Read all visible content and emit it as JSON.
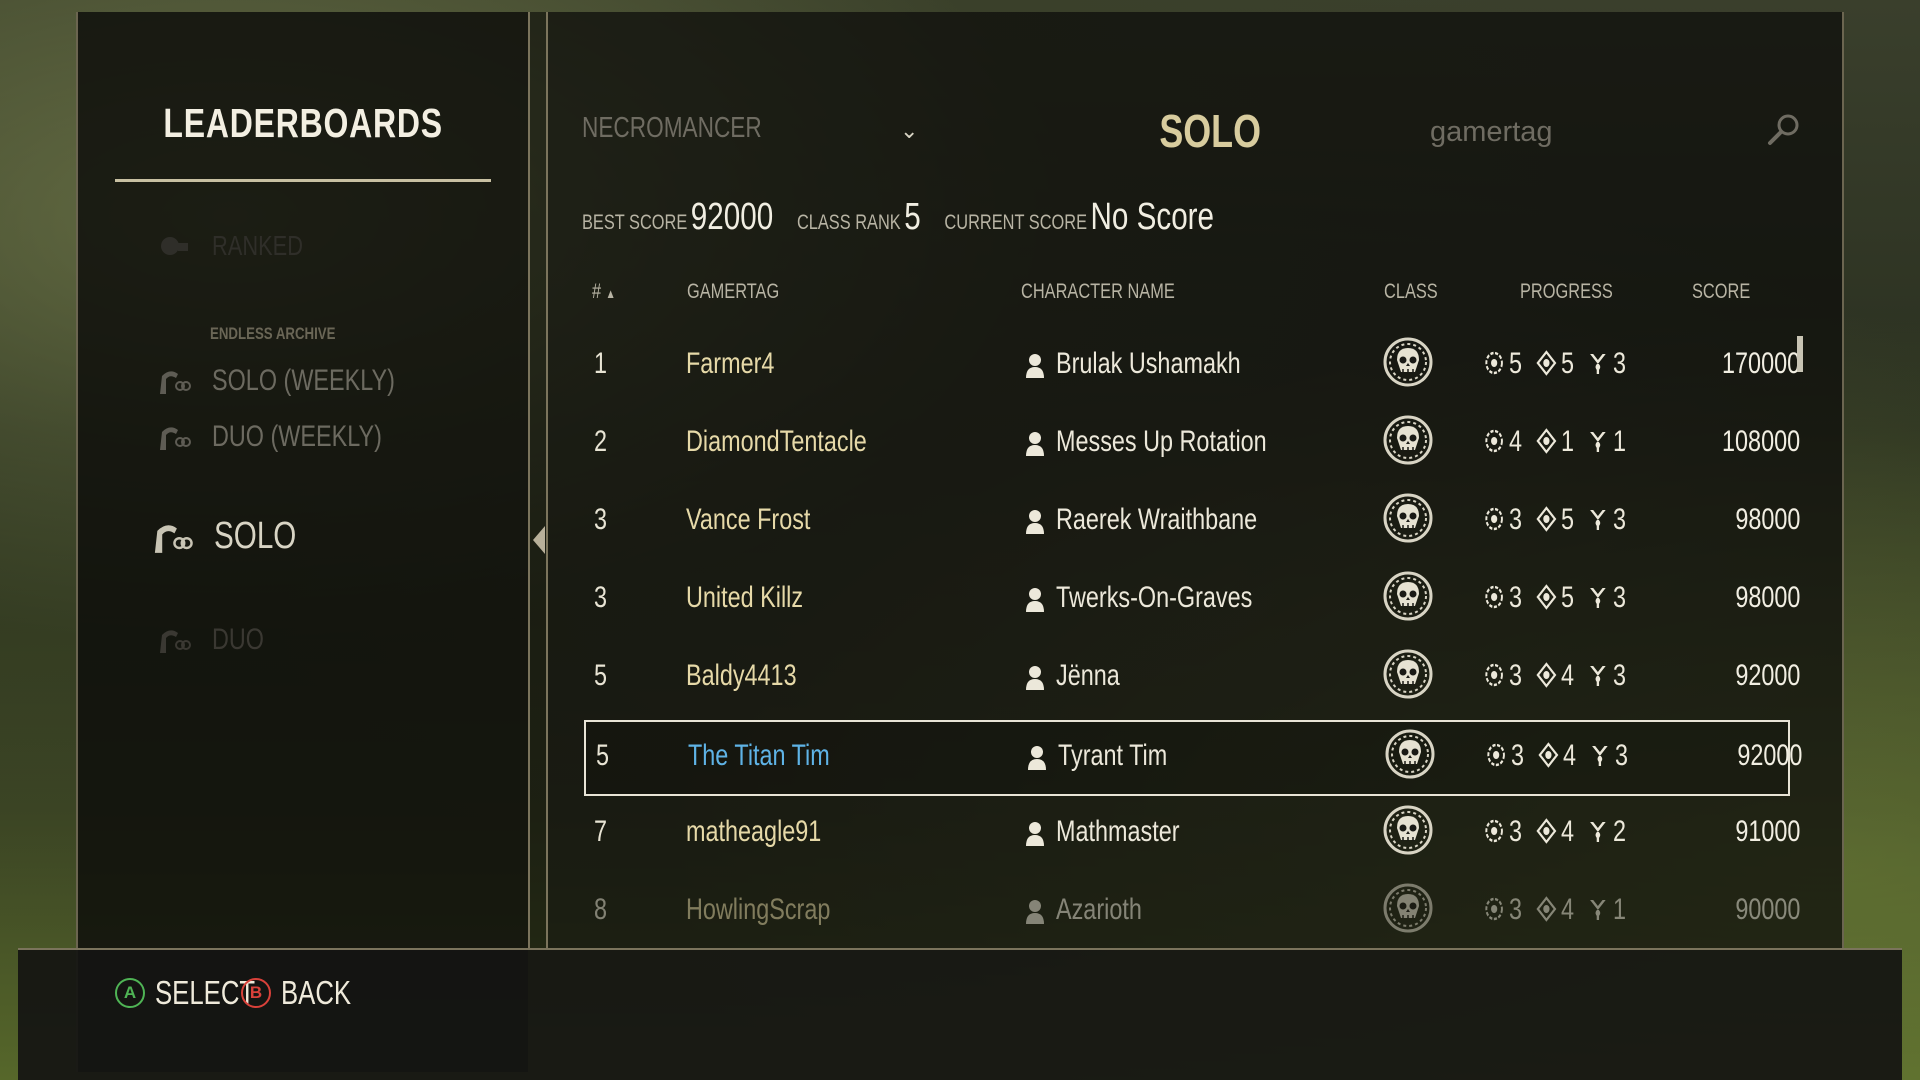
{
  "sidebar": {
    "title": "LEADERBOARDS",
    "items": [
      {
        "label": "RANKED",
        "state": "disabled"
      },
      {
        "label": "SOLO (WEEKLY)",
        "state": "normal"
      },
      {
        "label": "DUO (WEEKLY)",
        "state": "normal"
      },
      {
        "label": "SOLO",
        "state": "selected"
      },
      {
        "label": "DUO",
        "state": "disabled"
      }
    ],
    "section_label": "ENDLESS ARCHIVE"
  },
  "header": {
    "class_filter": "NECROMANCER",
    "mode_title": "SOLO",
    "search_placeholder": "gamertag"
  },
  "stats": {
    "best_score_label": "BEST SCORE",
    "best_score": "92000",
    "class_rank_label": "CLASS RANK",
    "class_rank": "5",
    "current_score_label": "CURRENT SCORE",
    "current_score": "No Score"
  },
  "table": {
    "columns": [
      "#",
      "GAMERTAG",
      "CHARACTER NAME",
      "CLASS",
      "PROGRESS",
      "SCORE"
    ],
    "sort_indicator": "▲",
    "rows": [
      {
        "rank": "1",
        "gamertag": "Farmer4",
        "character": "Brulak Ushamakh",
        "class_icon": "necromancer-skull-icon",
        "p1": "5",
        "p2": "5",
        "p3": "3",
        "score": "170000"
      },
      {
        "rank": "2",
        "gamertag": "DiamondTentacle",
        "character": "Messes Up Rotation",
        "class_icon": "necromancer-skull-icon",
        "p1": "4",
        "p2": "1",
        "p3": "1",
        "score": "108000"
      },
      {
        "rank": "3",
        "gamertag": "Vance Frost",
        "character": "Raerek Wraithbane",
        "class_icon": "necromancer-skull-icon",
        "p1": "3",
        "p2": "5",
        "p3": "3",
        "score": "98000"
      },
      {
        "rank": "3",
        "gamertag": "United Killz",
        "character": "Twerks-On-Graves",
        "class_icon": "necromancer-skull-icon",
        "p1": "3",
        "p2": "5",
        "p3": "3",
        "score": "98000"
      },
      {
        "rank": "5",
        "gamertag": "Baldy4413",
        "character": "Jënna",
        "class_icon": "necromancer-skull-icon",
        "p1": "3",
        "p2": "4",
        "p3": "3",
        "score": "92000"
      },
      {
        "rank": "5",
        "gamertag": "The Titan Tim",
        "character": "Tyrant Tim",
        "class_icon": "necromancer-skull-icon",
        "p1": "3",
        "p2": "4",
        "p3": "3",
        "score": "92000"
      },
      {
        "rank": "7",
        "gamertag": "matheagle91",
        "character": "Mathmaster",
        "class_icon": "necromancer-skull-icon",
        "p1": "3",
        "p2": "4",
        "p3": "2",
        "score": "91000"
      },
      {
        "rank": "8",
        "gamertag": "HowlingScrap",
        "character": "Azarioth",
        "class_icon": "necromancer-skull-icon",
        "p1": "3",
        "p2": "4",
        "p3": "1",
        "score": "90000"
      }
    ]
  },
  "footer": {
    "select_key": "A",
    "select_label": "SELECT",
    "back_key": "B",
    "back_label": "BACK"
  },
  "colors": {
    "selected_gamertag": "#5fb3e6",
    "gamertag": "#e6d9a8",
    "select_button": "#4fb455",
    "back_button": "#d9413a"
  }
}
